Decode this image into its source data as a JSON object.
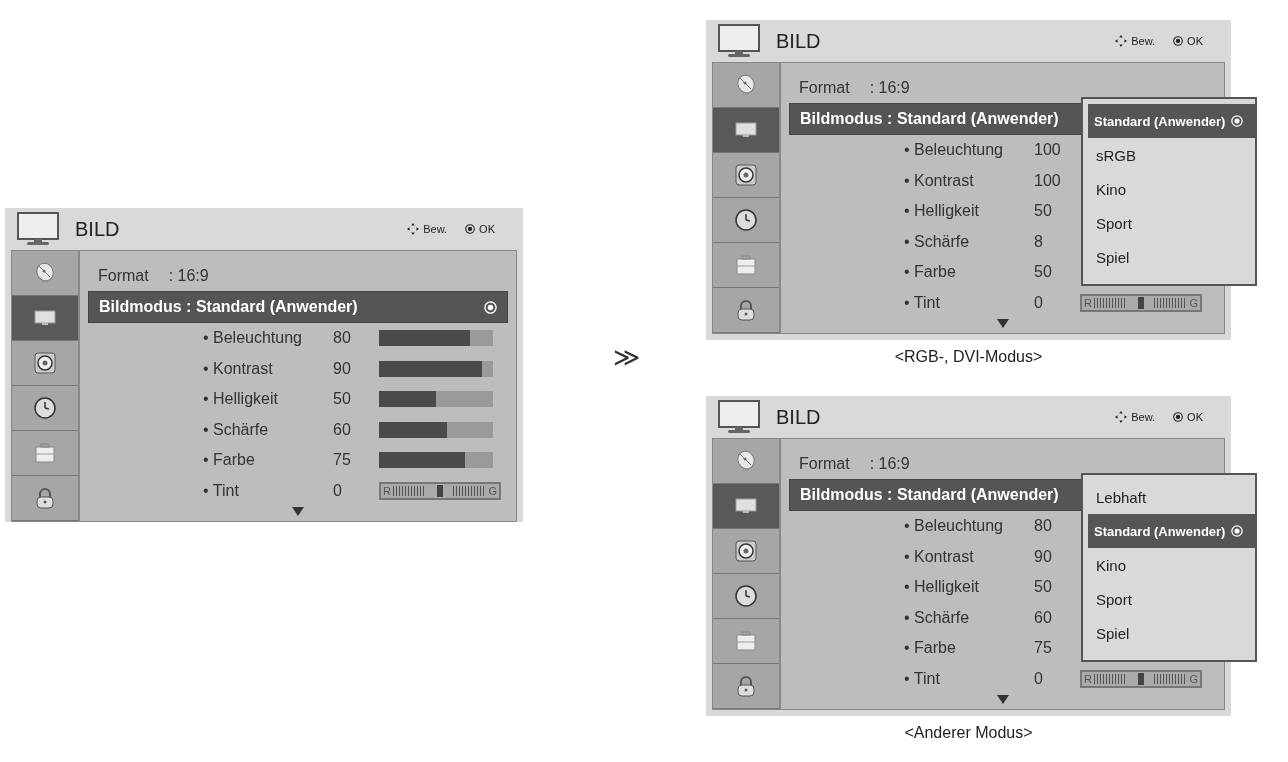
{
  "panels": [
    {
      "title": "BILD",
      "hints": [
        {
          "kind": "move",
          "label": "Bew."
        },
        {
          "kind": "ok",
          "label": "OK"
        }
      ],
      "sidebar": [
        {
          "kind": "dish",
          "selected": false
        },
        {
          "kind": "tv",
          "selected": true
        },
        {
          "kind": "speaker",
          "selected": false
        },
        {
          "kind": "clock",
          "selected": false
        },
        {
          "kind": "case",
          "selected": false
        },
        {
          "kind": "lock",
          "selected": false
        }
      ],
      "menu": [
        {
          "kind": "option",
          "label": "Format",
          "value": ": 16:9",
          "selected": false,
          "ok_icon": false
        },
        {
          "kind": "option",
          "label": "Bildmodus : Standard (Anwender)",
          "selected": true,
          "ok_icon": true
        },
        {
          "kind": "bar",
          "label": "• Beleuchtung",
          "value": "80",
          "level": 0.8
        },
        {
          "kind": "bar",
          "label": "• Kontrast",
          "value": "90",
          "level": 0.9
        },
        {
          "kind": "bar",
          "label": "• Helligkeit",
          "value": "50",
          "level": 0.5
        },
        {
          "kind": "bar",
          "label": "• Schärfe",
          "value": "60",
          "level": 0.6
        },
        {
          "kind": "bar",
          "label": "• Farbe",
          "value": "75",
          "level": 0.75
        },
        {
          "kind": "tint",
          "label": "• Tint",
          "value": "0",
          "level": 0.5,
          "left_label": "R",
          "right_label": "G"
        }
      ]
    },
    {
      "title": "BILD",
      "hints": [
        {
          "kind": "move",
          "label": "Bew."
        },
        {
          "kind": "ok",
          "label": "OK"
        }
      ],
      "sidebar": [
        {
          "kind": "dish",
          "selected": false
        },
        {
          "kind": "tv",
          "selected": true
        },
        {
          "kind": "speaker",
          "selected": false
        },
        {
          "kind": "clock",
          "selected": false
        },
        {
          "kind": "case",
          "selected": false
        },
        {
          "kind": "lock",
          "selected": false
        }
      ],
      "menu": [
        {
          "kind": "option",
          "label": "Format",
          "value": ": 16:9",
          "selected": false,
          "ok_icon": false
        },
        {
          "kind": "option",
          "label": "Bildmodus : Standard (Anwender)",
          "selected": true,
          "ok_icon": false
        },
        {
          "kind": "value",
          "label": "• Beleuchtung",
          "value": "100"
        },
        {
          "kind": "value",
          "label": "• Kontrast",
          "value": "100"
        },
        {
          "kind": "value",
          "label": "• Helligkeit",
          "value": "50"
        },
        {
          "kind": "value",
          "label": "• Schärfe",
          "value": "8"
        },
        {
          "kind": "value",
          "label": "• Farbe",
          "value": "50"
        },
        {
          "kind": "tint",
          "label": "• Tint",
          "value": "0",
          "level": 0.5,
          "left_label": "R",
          "right_label": "G"
        }
      ],
      "dropdown": [
        {
          "label": "Standard (Anwender)",
          "selected": true
        },
        {
          "label": "sRGB",
          "selected": false
        },
        {
          "label": "Kino",
          "selected": false
        },
        {
          "label": "Sport",
          "selected": false
        },
        {
          "label": "Spiel",
          "selected": false
        }
      ],
      "caption": "<RGB-, DVI-Modus>"
    },
    {
      "title": "BILD",
      "hints": [
        {
          "kind": "move",
          "label": "Bew."
        },
        {
          "kind": "ok",
          "label": "OK"
        }
      ],
      "sidebar": [
        {
          "kind": "dish",
          "selected": false
        },
        {
          "kind": "tv",
          "selected": true
        },
        {
          "kind": "speaker",
          "selected": false
        },
        {
          "kind": "clock",
          "selected": false
        },
        {
          "kind": "case",
          "selected": false
        },
        {
          "kind": "lock",
          "selected": false
        }
      ],
      "menu": [
        {
          "kind": "option",
          "label": "Format",
          "value": ": 16:9",
          "selected": false,
          "ok_icon": false
        },
        {
          "kind": "option",
          "label": "Bildmodus : Standard (Anwender)",
          "selected": true,
          "ok_icon": false
        },
        {
          "kind": "value",
          "label": "• Beleuchtung",
          "value": "80"
        },
        {
          "kind": "value",
          "label": "• Kontrast",
          "value": "90"
        },
        {
          "kind": "value",
          "label": "• Helligkeit",
          "value": "50"
        },
        {
          "kind": "value",
          "label": "• Schärfe",
          "value": "60"
        },
        {
          "kind": "value",
          "label": "• Farbe",
          "value": "75"
        },
        {
          "kind": "tint",
          "label": "• Tint",
          "value": "0",
          "level": 0.5,
          "left_label": "R",
          "right_label": "G"
        }
      ],
      "dropdown": [
        {
          "label": "Lebhaft",
          "selected": false
        },
        {
          "label": "Standard (Anwender)",
          "selected": true
        },
        {
          "label": "Kino",
          "selected": false
        },
        {
          "label": "Sport",
          "selected": false
        },
        {
          "label": "Spiel",
          "selected": false
        }
      ],
      "caption": "<Anderer Modus>"
    }
  ],
  "arrow": "≫"
}
